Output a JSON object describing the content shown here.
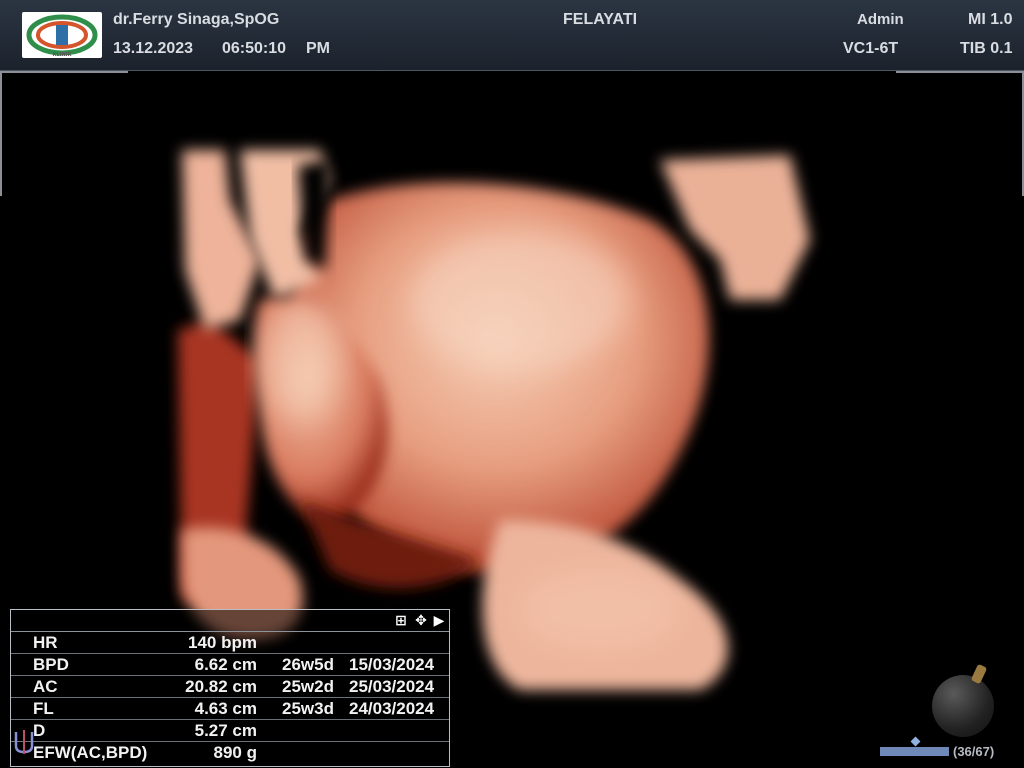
{
  "header": {
    "logo_icon": "clinic-logo-icon",
    "doctor": "dr.Ferry Sinaga,SpOG",
    "date": "13.12.2023",
    "time": "06:50:10",
    "ampm": "PM",
    "patient": "FELAYATI",
    "operator": "Admin",
    "probe": "VC1-6T",
    "mi": "MI 1.0",
    "tib": "TIB 0.1"
  },
  "colors": {
    "header_bg": "#222a34",
    "render_light": "#f3c3a6",
    "render_mid": "#d9826a",
    "render_dark": "#8a2418",
    "cine_bar": "#6e88b8"
  },
  "measurements": {
    "toolbar_icons": [
      "grid-icon",
      "move-icon",
      "arrow-right-icon"
    ],
    "rows": [
      {
        "label": "HR",
        "value": "140 bpm",
        "ga": "",
        "edd": ""
      },
      {
        "label": "BPD",
        "value": "6.62 cm",
        "ga": "26w5d",
        "edd": "15/03/2024"
      },
      {
        "label": "AC",
        "value": "20.82 cm",
        "ga": "25w2d",
        "edd": "25/03/2024"
      },
      {
        "label": "FL",
        "value": "4.63 cm",
        "ga": "25w3d",
        "edd": "24/03/2024"
      },
      {
        "label": "D",
        "value": "5.27 cm",
        "ga": "",
        "edd": ""
      },
      {
        "label": "EFW(AC,BPD)",
        "value": "890 g",
        "ga": "",
        "edd": ""
      }
    ]
  },
  "cine": {
    "counter": "(36/67)",
    "current_frame": 36,
    "total_frames": 67
  },
  "icons": {
    "orientation": "orientation-ball-icon",
    "bottom_left": "probe-orientation-icon"
  }
}
